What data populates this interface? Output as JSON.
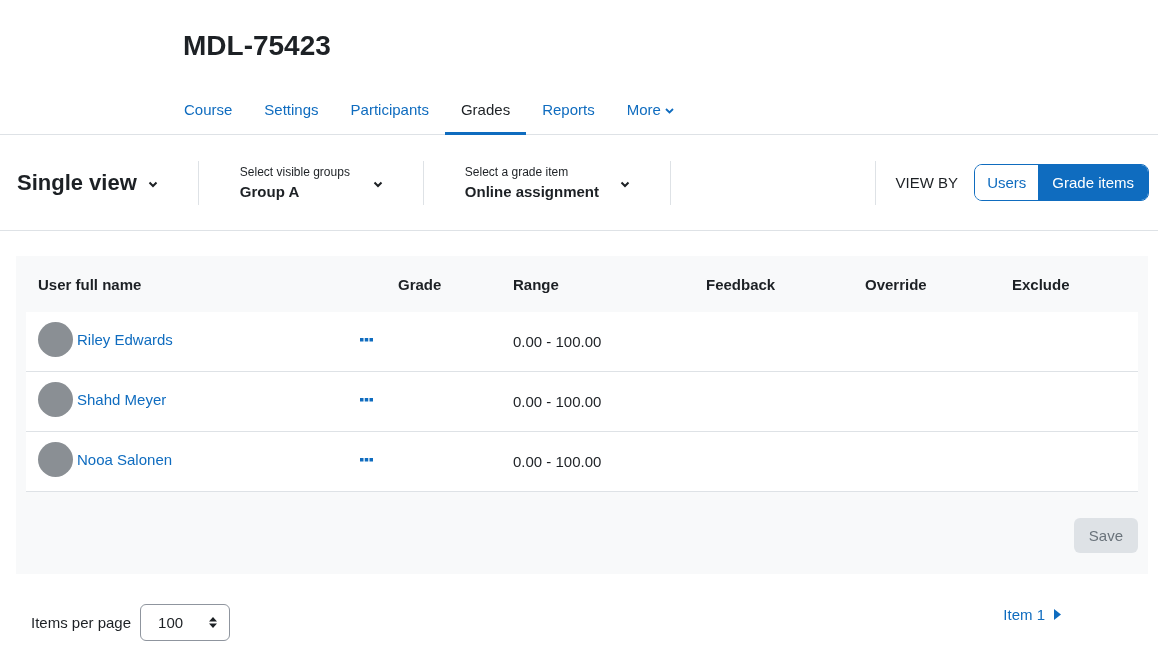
{
  "course_title": "MDL-75423",
  "nav_tabs": [
    {
      "label": "Course",
      "selected": false,
      "kind": "link"
    },
    {
      "label": "Settings",
      "selected": false,
      "kind": "link"
    },
    {
      "label": "Participants",
      "selected": false,
      "kind": "link"
    },
    {
      "label": "Grades",
      "selected": true,
      "kind": "link"
    },
    {
      "label": "Reports",
      "selected": false,
      "kind": "link"
    },
    {
      "label": "More",
      "selected": false,
      "kind": "menu"
    }
  ],
  "toolbar": {
    "page_selector": "Single view",
    "dropdowns": [
      {
        "label": "Select visible groups",
        "value": "Group A"
      },
      {
        "label": "Select a grade item",
        "value": "Online assignment"
      }
    ],
    "view_by_label": "VIEW BY",
    "view_by_options": [
      {
        "label": "Users",
        "selected": false
      },
      {
        "label": "Grade items",
        "selected": true
      }
    ]
  },
  "table": {
    "columns": [
      "User full name",
      "Grade",
      "Range",
      "Feedback",
      "Override",
      "Exclude"
    ],
    "rows": [
      {
        "name": "Riley Edwards",
        "range": "0.00 - 100.00"
      },
      {
        "name": "Shahd Meyer",
        "range": "0.00 - 100.00"
      },
      {
        "name": "Nooa Salonen",
        "range": "0.00 - 100.00"
      }
    ]
  },
  "save_button": {
    "label": "Save",
    "disabled": true
  },
  "footer": {
    "items_per_page_label": "Items per page",
    "items_per_page": "100",
    "next_link": "Item 1"
  }
}
